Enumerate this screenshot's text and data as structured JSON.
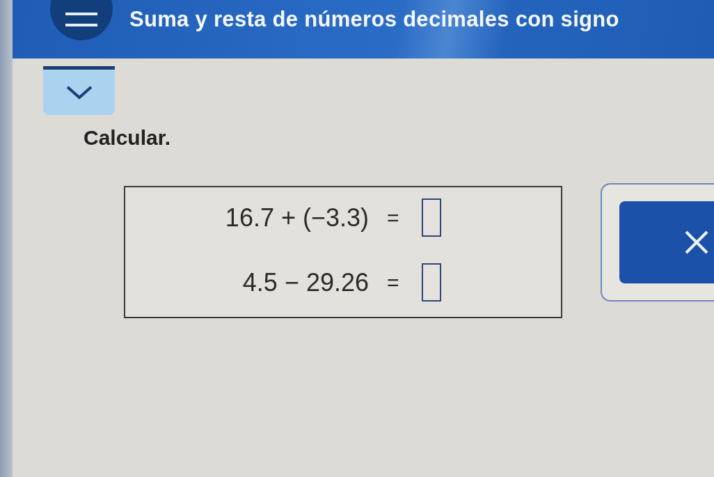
{
  "header": {
    "title": "Suma y resta de números decimales con signo"
  },
  "collapse_tab": {
    "expanded": false
  },
  "prompt": "Calcular.",
  "equations": [
    {
      "expression": "16.7 + (−3.3)",
      "equals": "="
    },
    {
      "expression": "4.5 − 29.26",
      "equals": "="
    }
  ]
}
